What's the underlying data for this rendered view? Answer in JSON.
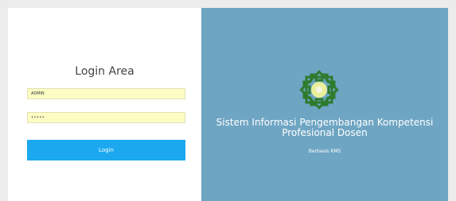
{
  "login": {
    "title": "Login Area",
    "username_value": "ADMIN",
    "password_value": "•••••",
    "button_label": "Login"
  },
  "branding": {
    "title": "Sistem Informasi Pengembangan Kompetensi Profesional Dosen",
    "subtitle": "Berbasis KMS",
    "logo_icon": "university-emblem-icon"
  },
  "colors": {
    "panel_background": "#6ea5c3",
    "input_background": "#fbfdc3",
    "button_background": "#1ba8ef",
    "logo_green": "#2d7b2d",
    "logo_center": "#e9ef9a"
  }
}
